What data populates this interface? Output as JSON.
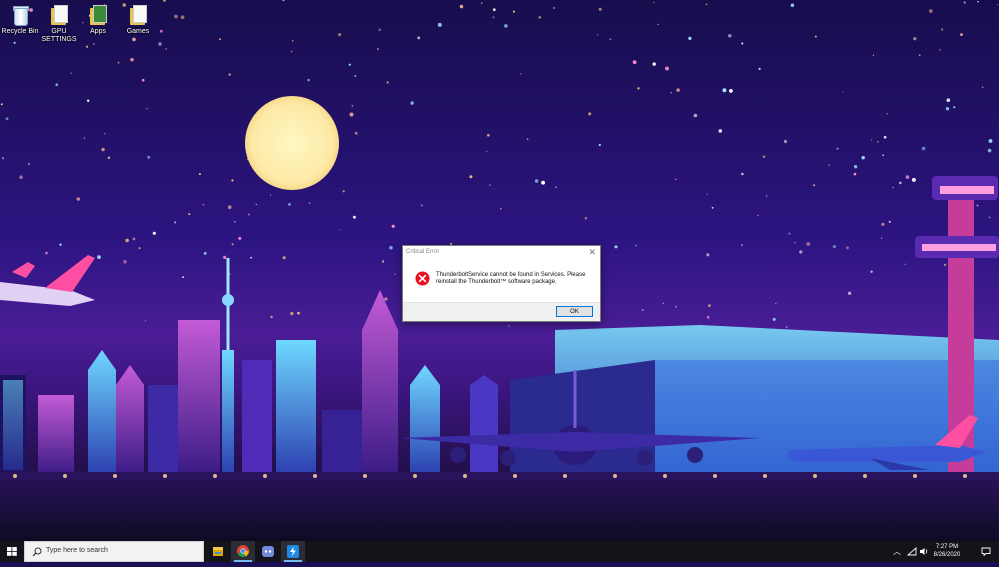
{
  "desktop_icons": [
    {
      "label": "Recycle Bin",
      "icon": "recycle-bin-icon"
    },
    {
      "label": "GPU SETTINGS",
      "icon": "folder-icon"
    },
    {
      "label": "Apps",
      "icon": "folder-icon"
    },
    {
      "label": "Games",
      "icon": "folder-icon"
    }
  ],
  "dialog": {
    "title": "Critical Error",
    "message": "ThunderboltService cannot be found in Services. Please reinstall the Thunderbolt™ software package.",
    "ok_label": "OK",
    "icon": "error-icon"
  },
  "taskbar": {
    "search_placeholder": "Type here to search",
    "apps": [
      {
        "name": "File Explorer",
        "icon": "file-explorer-icon"
      },
      {
        "name": "Google Chrome",
        "icon": "chrome-icon"
      },
      {
        "name": "Discord",
        "icon": "discord-icon"
      },
      {
        "name": "Thunderbolt",
        "icon": "thunderbolt-icon"
      }
    ],
    "time": "7:27 PM",
    "date": "8/26/2020"
  },
  "colors": {
    "accent": "#0078d7",
    "error_red": "#e81123",
    "taskbar": "#13131a"
  }
}
